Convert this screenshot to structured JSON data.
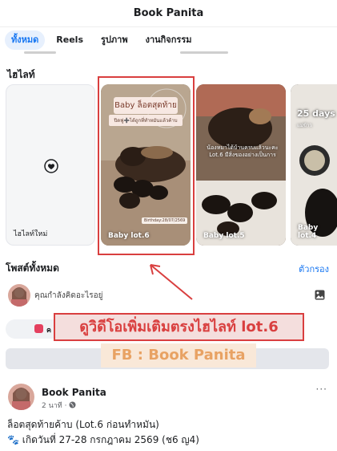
{
  "header": {
    "title": "Book Panita"
  },
  "tabs": [
    {
      "label": "ทั้งหมด",
      "active": true
    },
    {
      "label": "Reels"
    },
    {
      "label": "รูปภาพ"
    },
    {
      "label": "งานกิจกรรม"
    }
  ],
  "highlights": {
    "section_title": "ไฮไลท์",
    "new_label": "ไฮไลท์ใหม่",
    "items": [
      {
        "label": "Baby lot.6",
        "overlay_title": "Baby ล็อตสุดท้าย",
        "overlay_sub": "ปิดฟู➕ได้ถูกที่ทำหมันแล้วค้าบ",
        "overlay_bday": "Birthday:28/07/2569"
      },
      {
        "label": "Baby lot.5",
        "caption": "น้องหมาได้บ้านครบแล้วนะคะ Lot.6 มีสิ่งของอย่างเป็นการ"
      },
      {
        "label": "Baby lot.4",
        "overlay_title": "25 days",
        "overlay_sub": "แม่ข้าว"
      }
    ]
  },
  "posts_section": {
    "title": "โพสต์ทั้งหมด",
    "filter_label": "ตัวกรอง"
  },
  "composer": {
    "placeholder": "คุณกำลังคิดอะไรอยู่"
  },
  "chip": {
    "label": "ค"
  },
  "annotation": {
    "banner": "ดูวิดีโอเพิ่มเติมตรงไฮไลท์ lot.6",
    "fb_tag": "FB : Book Panita"
  },
  "post": {
    "author": "Book Panita",
    "meta": "2 นาที · ",
    "more": "···",
    "line1": "ล็อตสุดท้ายค้าบ (Lot.6 ก่อนทำหมัน)",
    "line2": "🐾 เกิดวันที่ 27-28 กรกฎาคม 2569 (ช6 ญ4)"
  },
  "colors": {
    "accent": "#1877f2",
    "annotation_red": "#d93f3f",
    "fb_tag_text": "#e8a263"
  }
}
